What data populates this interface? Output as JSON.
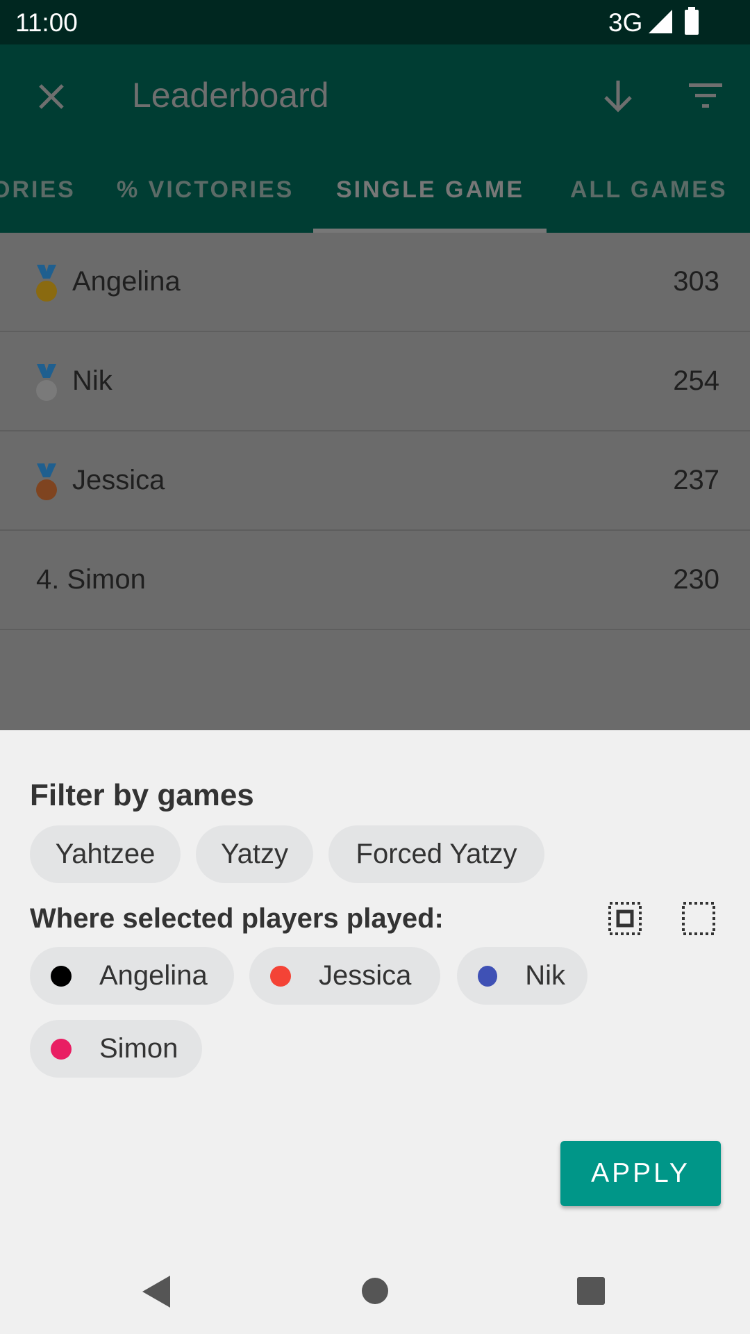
{
  "status_bar": {
    "time": "11:00",
    "network": "3G"
  },
  "toolbar": {
    "title": "Leaderboard",
    "icons": [
      "close-icon",
      "arrow-down-icon",
      "filter-icon"
    ]
  },
  "tabs": [
    {
      "label": "VICTORIES",
      "visible": "ORIES"
    },
    {
      "label": "% VICTORIES"
    },
    {
      "label": "SINGLE GAME",
      "selected": true
    },
    {
      "label": "ALL GAMES"
    }
  ],
  "leaderboard": [
    {
      "name": "Angelina",
      "score": "303",
      "medal": "gold",
      "color": "#d4a017"
    },
    {
      "name": "Nik",
      "score": "254",
      "medal": "silver",
      "color": "#a0a0a0"
    },
    {
      "name": "Jessica",
      "score": "237",
      "medal": "bronze",
      "color": "#c0642a"
    },
    {
      "name": "4. Simon",
      "score": "230"
    }
  ],
  "filter": {
    "games_title": "Filter by games",
    "games": [
      "Yahtzee",
      "Yatzy",
      "Forced Yatzy"
    ],
    "players_title": "Where selected players played:",
    "players": [
      {
        "name": "Angelina",
        "color": "#000000"
      },
      {
        "name": "Jessica",
        "color": "#f44336"
      },
      {
        "name": "Nik",
        "color": "#3f51b5"
      },
      {
        "name": "Simon",
        "color": "#e91e63"
      }
    ],
    "apply_label": "APPLY"
  }
}
